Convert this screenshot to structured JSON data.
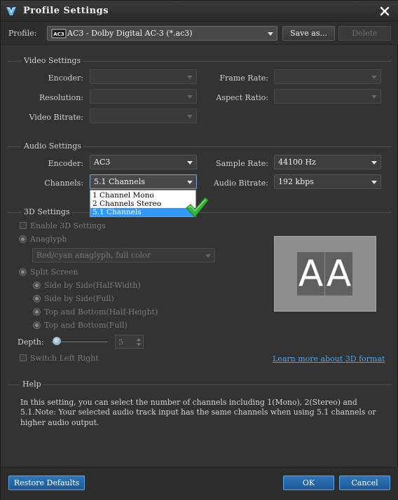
{
  "window": {
    "title": "Profile Settings"
  },
  "profile": {
    "label": "Profile:",
    "value": "AC3 - Dolby Digital AC-3 (*.ac3)",
    "icon_badge": "AC3",
    "save_as_label": "Save as...",
    "delete_label": "Delete"
  },
  "video": {
    "section_title": "Video Settings",
    "encoder_label": "Encoder:",
    "encoder_value": "",
    "frame_rate_label": "Frame Rate:",
    "frame_rate_value": "",
    "resolution_label": "Resolution:",
    "resolution_value": "",
    "aspect_ratio_label": "Aspect Ratio:",
    "aspect_ratio_value": "",
    "bitrate_label": "Video Bitrate:",
    "bitrate_value": ""
  },
  "audio": {
    "section_title": "Audio Settings",
    "encoder_label": "Encoder:",
    "encoder_value": "AC3",
    "sample_rate_label": "Sample Rate:",
    "sample_rate_value": "44100 Hz",
    "channels_label": "Channels:",
    "channels_value": "5.1 Channels",
    "audio_bitrate_label": "Audio Bitrate:",
    "audio_bitrate_value": "192 kbps",
    "channel_options": [
      "1 Channel Mono",
      "2 Channels Stereo",
      "5.1 Channels"
    ],
    "selected_channel_index": 2
  },
  "three_d": {
    "section_title": "3D Settings",
    "enable_label": "Enable 3D Settings",
    "anaglyph_label": "Anaglyph",
    "anaglyph_value": "Red/cyan anaglyph, full color",
    "split_screen_label": "Split Screen",
    "sbs_half_label": "Side by Side(Half-Width)",
    "sbs_full_label": "Side by Side(Full)",
    "tb_half_label": "Top and Bottom(Half-Height)",
    "tb_full_label": "Top and Bottom(Full)",
    "depth_label": "Depth:",
    "depth_value": "5",
    "switch_label": "Switch Left Right",
    "learn_more_label": "Learn more about 3D format",
    "preview_left": "A",
    "preview_right": "A"
  },
  "help": {
    "section_title": "Help",
    "text": "In this setting, you can select the number of channels including 1(Mono), 2(Stereo) and 5.1.Note: Your selected audio track input has the same channels when using 5.1 channels or higher audio output."
  },
  "footer": {
    "restore_label": "Restore Defaults",
    "ok_label": "OK",
    "cancel_label": "Cancel"
  },
  "colors": {
    "background": "#333333",
    "accent_blue": "#1f5a96",
    "link": "#4ea3e8",
    "selection": "#3399ff",
    "checkmark": "#3cb43c"
  },
  "icons": [
    "app-logo-icon",
    "close-icon",
    "audio-file-icon",
    "dropdown-arrow-icon",
    "checkmark-icon"
  ]
}
